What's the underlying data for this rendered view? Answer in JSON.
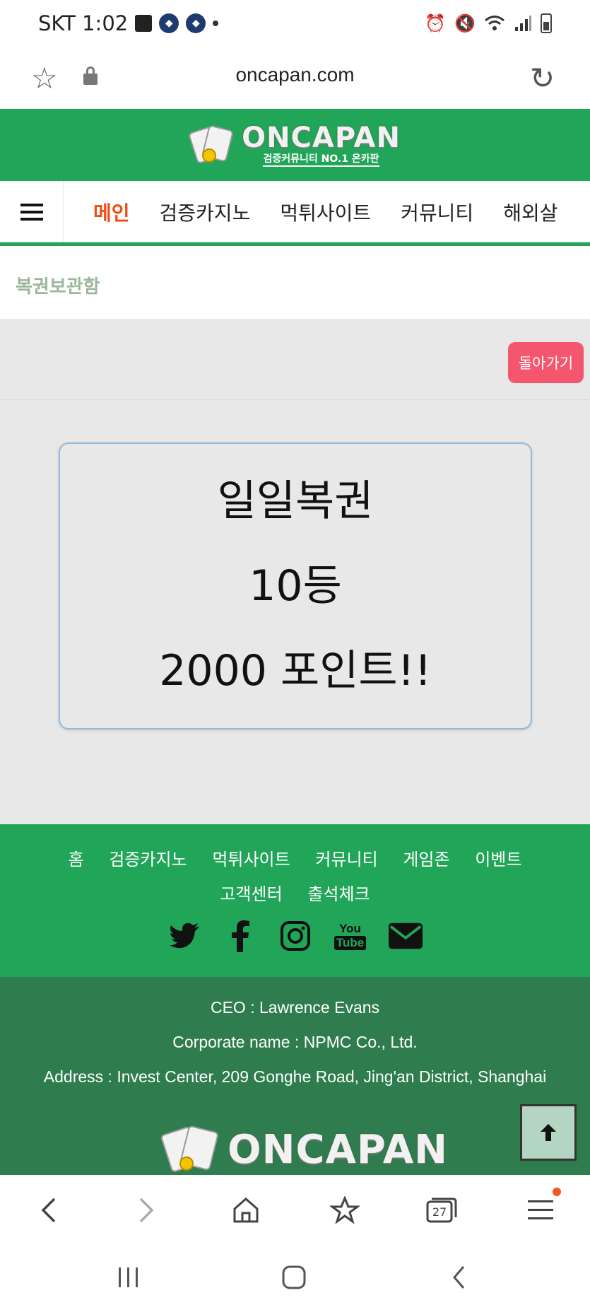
{
  "status_bar": {
    "carrier_time": "SKT 1:02",
    "notification_icons": [
      "image-icon",
      "app-icon",
      "app-icon"
    ],
    "right_icons": [
      "alarm-icon",
      "mute-icon",
      "wifi-icon",
      "signal-icon",
      "battery-icon"
    ]
  },
  "browser": {
    "url": "oncapan.com",
    "tab_count": "27"
  },
  "site": {
    "logo_text": "ONCAPAN",
    "logo_subtext": "검증커뮤니티 NO.1 온카판",
    "nav_items": [
      "메인",
      "검증카지노",
      "먹튀사이트",
      "커뮤니티",
      "해외살"
    ],
    "active_nav": "메인",
    "breadcrumb": "복권보관함",
    "back_button": "돌아가기",
    "prize": {
      "line1": "일일복권",
      "line2": "10등",
      "line3": "2000 포인트!!"
    }
  },
  "footer": {
    "links_row1": [
      "홈",
      "검증카지노",
      "먹튀사이트",
      "커뮤니티",
      "게임존",
      "이벤트"
    ],
    "links_row2": [
      "고객센터",
      "출석체크"
    ],
    "social": [
      "twitter-icon",
      "facebook-icon",
      "instagram-icon",
      "youtube-icon",
      "email-icon"
    ],
    "youtube_label_top": "You",
    "youtube_label_bottom": "Tube",
    "ceo": "CEO : Lawrence Evans",
    "corporate": "Corporate name : NPMC Co., Ltd.",
    "address": "Address : Invest Center, 209 Gonghe Road, Jing'an District, Shanghai",
    "logo_text": "ONCAPAN"
  },
  "colors": {
    "brand_green": "#21a558",
    "footer_dark_green": "#2f7d4e",
    "active_nav": "#ee4d11",
    "back_button": "#f4566e",
    "breadcrumb_text": "#9bb79c"
  }
}
